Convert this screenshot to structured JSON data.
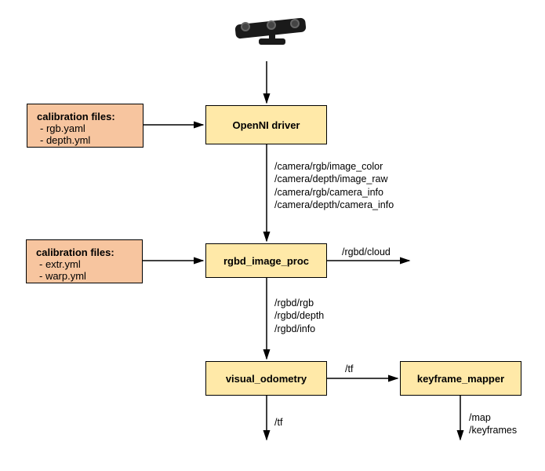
{
  "nodes": {
    "calib1": {
      "title": "calibration files:",
      "lines": [
        "- rgb.yaml",
        "- depth.yml"
      ]
    },
    "driver": "OpenNI driver",
    "calib2": {
      "title": "calibration files:",
      "lines": [
        "- extr.yml",
        "- warp.yml"
      ]
    },
    "image_proc": "rgbd_image_proc",
    "visual_odom": "visual_odometry",
    "keyframe": "keyframe_mapper"
  },
  "labels": {
    "edge_driver_proc": [
      "/camera/rgb/image_color",
      "/camera/depth/image_raw",
      "/camera/rgb/camera_info",
      "/camera/depth/camera_info"
    ],
    "edge_proc_cloud": "/rgbd/cloud",
    "edge_proc_vo": [
      "/rgbd/rgb",
      "/rgbd/depth",
      "/rgbd/info"
    ],
    "edge_vo_kf": "/tf",
    "edge_vo_out": "/tf",
    "edge_kf_out": [
      "/map",
      "/keyframes"
    ]
  }
}
